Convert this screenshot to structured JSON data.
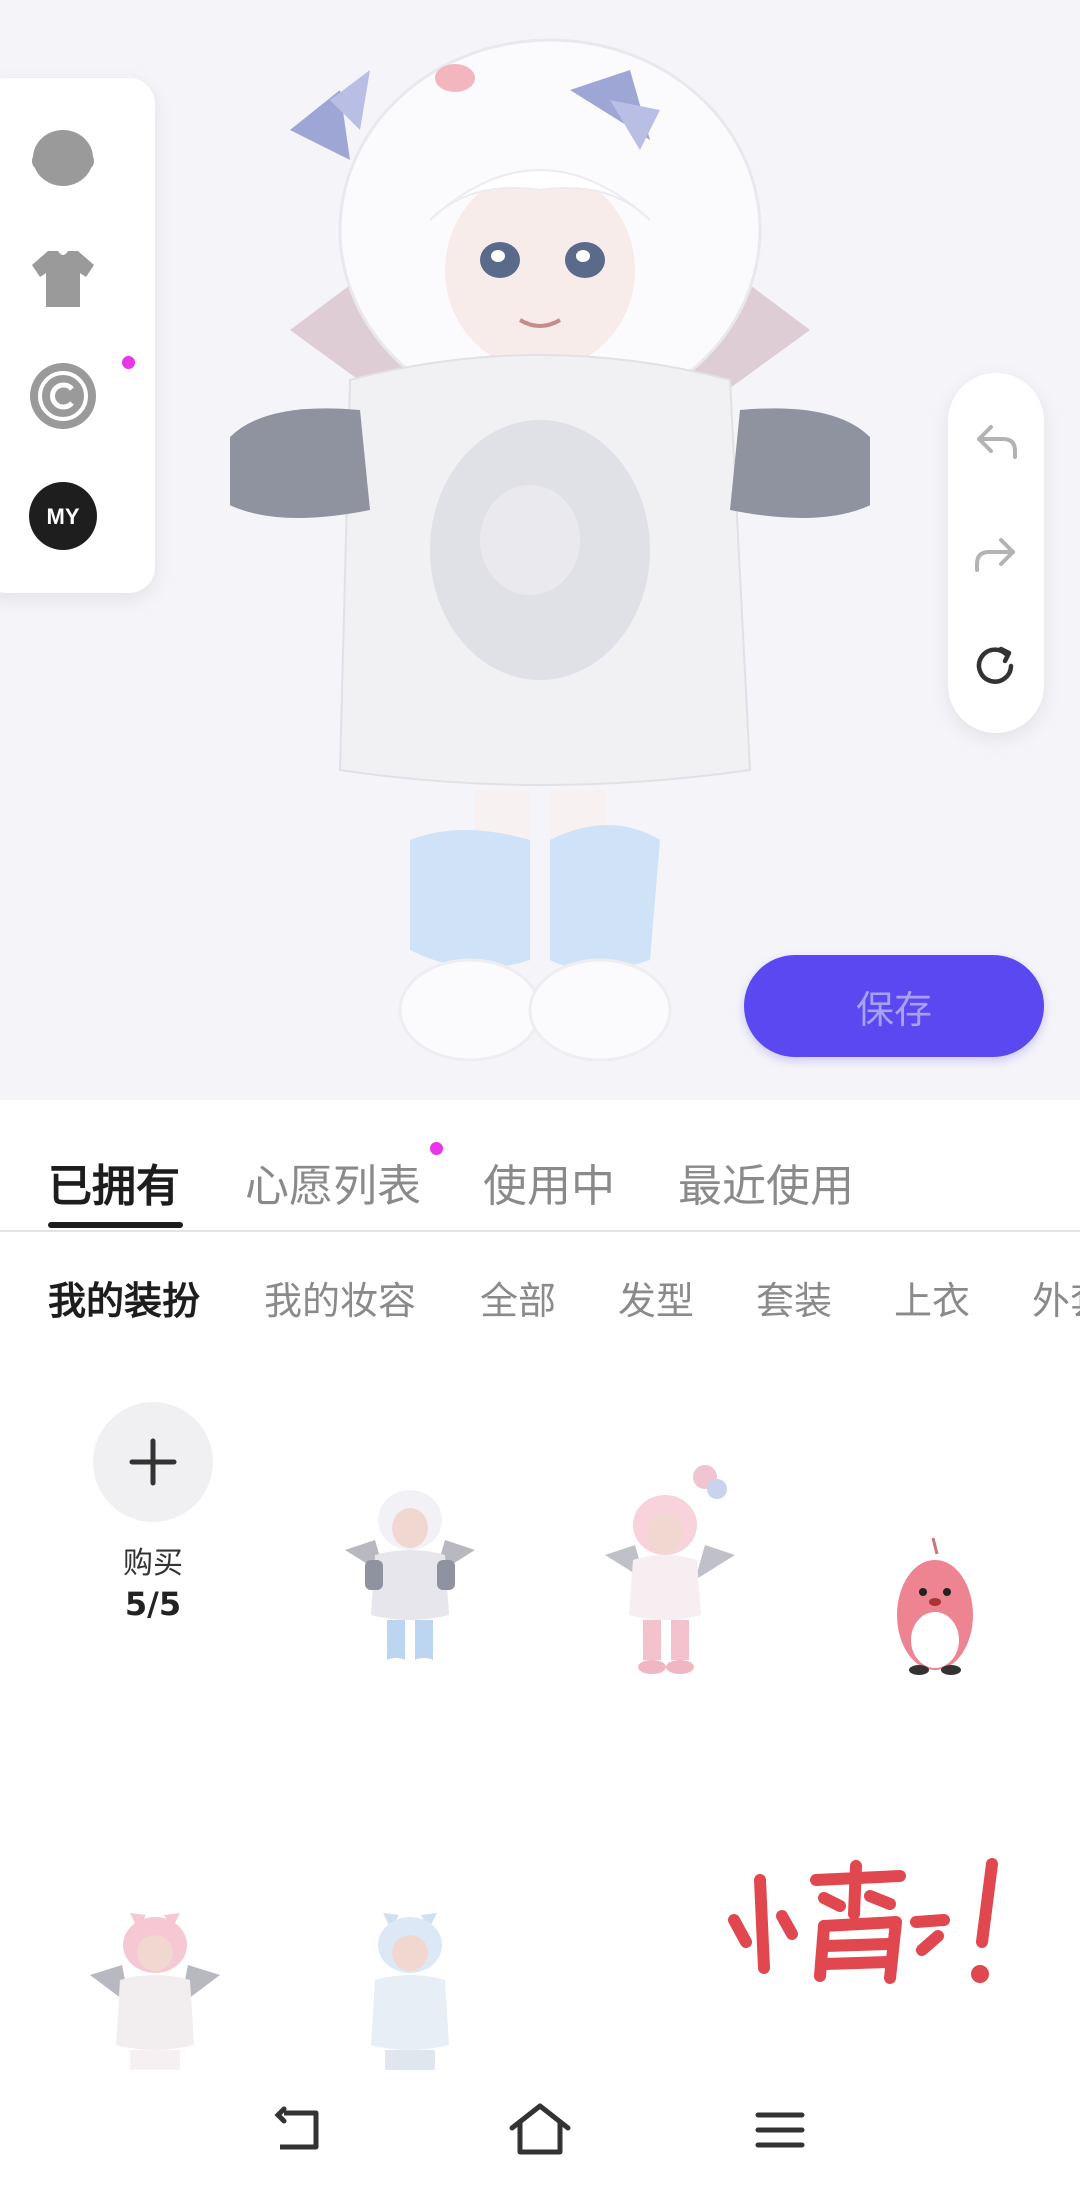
{
  "colors": {
    "accent": "#5a48f0",
    "save_text": "#a9a1f5",
    "notification_dot": "#e836e8",
    "tab_active": "#1d1d1d",
    "tab_inactive": "#8a8a8a",
    "watermark": "#e0474f"
  },
  "side_panel": {
    "items": [
      {
        "icon": "head-icon"
      },
      {
        "icon": "shirt-icon"
      },
      {
        "icon": "copyright-icon",
        "has_dot": true
      },
      {
        "icon": "my-icon",
        "label": "MY"
      }
    ]
  },
  "history": {
    "items": [
      {
        "icon": "undo-icon"
      },
      {
        "icon": "redo-icon"
      },
      {
        "icon": "reset-icon"
      }
    ]
  },
  "save_button": {
    "label": "保存"
  },
  "tabs": [
    {
      "label": "已拥有",
      "active": true
    },
    {
      "label": "心愿列表",
      "has_dot": true
    },
    {
      "label": "使用中"
    },
    {
      "label": "最近使用"
    }
  ],
  "subtabs": [
    {
      "label": "我的装扮",
      "active": true
    },
    {
      "label": "我的妆容"
    },
    {
      "label": "全部"
    },
    {
      "label": "发型"
    },
    {
      "label": "套装"
    },
    {
      "label": "上衣"
    },
    {
      "label": "外套"
    }
  ],
  "buy": {
    "label": "购买",
    "count": "5/5"
  },
  "watermark": {
    "text": "小霜!"
  },
  "nav": {
    "items": [
      {
        "icon": "back-icon"
      },
      {
        "icon": "home-icon"
      },
      {
        "icon": "menu-icon"
      }
    ]
  }
}
